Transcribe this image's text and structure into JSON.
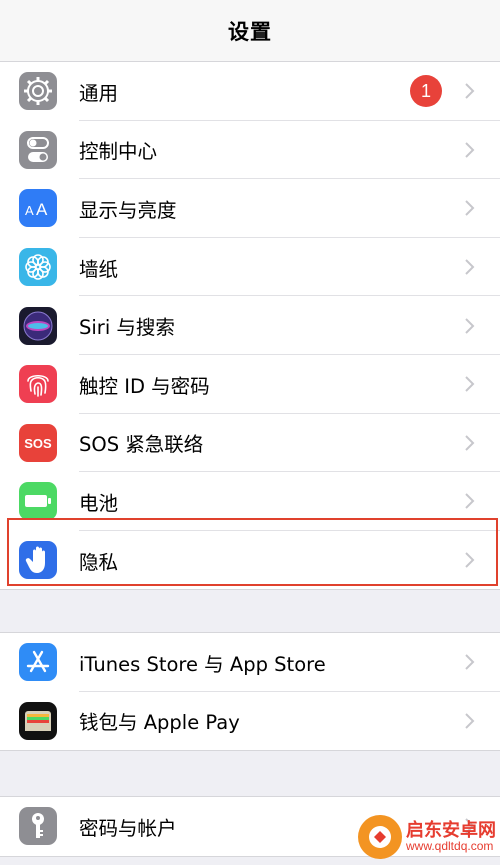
{
  "header": {
    "title": "设置"
  },
  "groups": [
    {
      "items": [
        {
          "label": "通用",
          "icon": "gear-icon",
          "color": "#8e8e93",
          "badge": "1"
        },
        {
          "label": "控制中心",
          "icon": "toggles-icon",
          "color": "#8e8e93"
        },
        {
          "label": "显示与亮度",
          "icon": "text-size-icon",
          "color": "#2f7cf6"
        },
        {
          "label": "墙纸",
          "icon": "flower-icon",
          "color": "#39b6e8"
        },
        {
          "label": "Siri 与搜索",
          "icon": "siri-icon",
          "color": "#1a1a2e"
        },
        {
          "label": "触控 ID 与密码",
          "icon": "fingerprint-icon",
          "color": "#ef3f52"
        },
        {
          "label": "SOS 紧急联络",
          "icon": "sos-icon",
          "color": "#e8423a"
        },
        {
          "label": "电池",
          "icon": "battery-icon",
          "color": "#4cd964"
        },
        {
          "label": "隐私",
          "icon": "hand-icon",
          "color": "#2f6ee8"
        }
      ]
    },
    {
      "items": [
        {
          "label": "iTunes Store 与 App Store",
          "icon": "app-store-icon",
          "color": "#2f8cf6"
        },
        {
          "label": "钱包与 Apple Pay",
          "icon": "wallet-icon",
          "color": "#111111"
        }
      ]
    },
    {
      "items": [
        {
          "label": "密码与帐户",
          "icon": "key-icon",
          "color": "#8e8e93"
        }
      ]
    }
  ],
  "highlight_color": "#e0412d",
  "watermark": {
    "name": "启东安卓网",
    "url": "www.qdltdq.com"
  }
}
